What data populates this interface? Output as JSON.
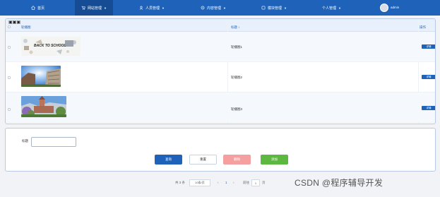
{
  "nav": {
    "items": [
      {
        "label": "首页",
        "icon": "home-icon"
      },
      {
        "label": "网站管理",
        "icon": "cart-icon"
      },
      {
        "label": "人员管理",
        "icon": "user-icon"
      },
      {
        "label": "内容管理",
        "icon": "content-icon"
      },
      {
        "label": "模块管理",
        "icon": "module-icon"
      },
      {
        "label": "个人管理",
        "icon": ""
      }
    ],
    "caret": "▼",
    "username": "admin"
  },
  "table": {
    "header_icon_text": "▣▣▣",
    "columns": [
      "轮播图",
      "标题",
      "操作"
    ],
    "sort_mark": "↕",
    "rows": [
      {
        "title": "轮播图1",
        "action": "详情",
        "image": "back-to-school"
      },
      {
        "title": "轮播图2",
        "action": "详情",
        "image": "campus-sky"
      },
      {
        "title": "轮播图3",
        "action": "详情",
        "image": "campus-tower"
      }
    ],
    "thumb_text": "BACK TO SCHOOL"
  },
  "search": {
    "label": "标题",
    "value": "",
    "buttons": {
      "query": "查询",
      "reset": "重置",
      "delete": "删除",
      "add": "添加"
    }
  },
  "pager": {
    "total": "共 3 条",
    "page_size": "10条/页",
    "prev": "‹",
    "page": "1",
    "next": "›",
    "goto_label": "前往",
    "goto_value": "1",
    "page_suffix": "页"
  },
  "watermark": "CSDN @程序辅导开发",
  "colors": {
    "nav": "#1e63b9",
    "query": "#1e63b9",
    "delete": "#f4a0a0",
    "add": "#5cb83f"
  }
}
